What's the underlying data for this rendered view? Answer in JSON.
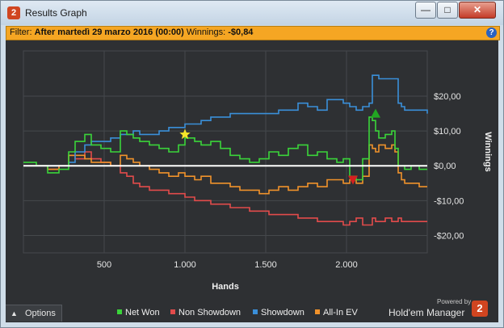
{
  "window": {
    "title": "Results Graph",
    "app_icon": "2"
  },
  "title_buttons": {
    "minimize": "—",
    "maximize": "□",
    "close": "✕"
  },
  "filter": {
    "prefix": "Filter:",
    "value": "After martedì 29 marzo 2016 (00:00)",
    "winnings_label": "Winnings:",
    "winnings_value": "-$0,84"
  },
  "footer": {
    "options_label": "Options",
    "powered_by": "Powered by",
    "brand": "Hold'em Manager",
    "brand_logo": "2"
  },
  "colors": {
    "net_won": "#3ad43a",
    "non_showdown": "#e24b4b",
    "showdown": "#3a8fd9",
    "all_in_ev": "#f0922b",
    "background": "#2e3033",
    "grid": "#45484c",
    "zero_line": "#ffffff",
    "accent": "#f5a623"
  },
  "chart_data": {
    "type": "line",
    "xlabel": "Hands",
    "ylabel": "Winnings",
    "xlim": [
      0,
      2500
    ],
    "ylim": [
      -25,
      33
    ],
    "x_ticks": [
      500,
      1000,
      1500,
      2000
    ],
    "x_tick_labels": [
      "500",
      "1.000",
      "1.500",
      "2.000"
    ],
    "y_ticks": [
      20,
      10,
      0,
      -10,
      -20
    ],
    "y_tick_labels": [
      "$20,00",
      "$10,00",
      "$0,00",
      "-$10,00",
      "-$20,00"
    ],
    "grid": true,
    "legend": "bottom",
    "x": [
      0,
      80,
      150,
      220,
      280,
      320,
      380,
      420,
      480,
      540,
      600,
      640,
      680,
      720,
      780,
      840,
      900,
      960,
      1000,
      1060,
      1100,
      1160,
      1220,
      1280,
      1340,
      1400,
      1460,
      1520,
      1580,
      1640,
      1700,
      1760,
      1820,
      1880,
      1940,
      1980,
      2020,
      2060,
      2100,
      2140,
      2160,
      2180,
      2200,
      2240,
      2280,
      2300,
      2320,
      2340,
      2360,
      2400,
      2450,
      2500
    ],
    "series": [
      {
        "name": "Net Won",
        "values": [
          1,
          0,
          -2,
          -1,
          4,
          7,
          9,
          6,
          5,
          4,
          10,
          9,
          8,
          7,
          6,
          5,
          4,
          6,
          8,
          7,
          6,
          7,
          5,
          3,
          2,
          1,
          2,
          4,
          3,
          5,
          6,
          3,
          4,
          2,
          1,
          2,
          -3,
          -4,
          2,
          14,
          13,
          10,
          8,
          9,
          10,
          5,
          0,
          0,
          -1,
          0,
          -1,
          -1
        ]
      },
      {
        "name": "Non Showdown",
        "values": [
          0,
          0,
          -1,
          0,
          3,
          2,
          4,
          2,
          1,
          0,
          -2,
          -3,
          -5,
          -6,
          -7,
          -7,
          -8,
          -8,
          -9,
          -10,
          -10,
          -11,
          -11,
          -12,
          -12,
          -13,
          -13,
          -14,
          -14,
          -14,
          -15,
          -15,
          -16,
          -16,
          -16,
          -17,
          -16,
          -15,
          -17,
          -17,
          -15,
          -16,
          -16,
          -15,
          -16,
          -16,
          -15,
          -16,
          -16,
          -16,
          -16,
          -16
        ]
      },
      {
        "name": "Showdown",
        "values": [
          0,
          0,
          0,
          0,
          1,
          4,
          6,
          7,
          7,
          8,
          9,
          9,
          10,
          9,
          9,
          10,
          11,
          11,
          12,
          12,
          13,
          14,
          14,
          15,
          15,
          15,
          15,
          15,
          16,
          16,
          18,
          17,
          16,
          19,
          19,
          18,
          17,
          16,
          17,
          18,
          26,
          26,
          25,
          25,
          25,
          25,
          18,
          17,
          16,
          16,
          16,
          15
        ]
      },
      {
        "name": "All-In EV",
        "values": [
          0,
          0,
          -1,
          0,
          3,
          3,
          2,
          1,
          1,
          0,
          3,
          2,
          1,
          0,
          -1,
          -2,
          -3,
          -2,
          -3,
          -4,
          -3,
          -5,
          -5,
          -6,
          -7,
          -7,
          -8,
          -7,
          -6,
          -7,
          -6,
          -5,
          -6,
          -4,
          -4,
          -5,
          -4,
          -5,
          -3,
          6,
          5,
          4,
          6,
          5,
          6,
          4,
          -2,
          -4,
          -5,
          -5,
          -6,
          -6
        ]
      }
    ],
    "markers": [
      {
        "type": "star",
        "series": "Net Won",
        "x": 1000,
        "y": 9,
        "color": "#f5e52a"
      },
      {
        "type": "triangle-up",
        "series": "Net Won",
        "x": 2180,
        "y": 15,
        "color": "#22a622"
      },
      {
        "type": "triangle-down",
        "series": "Net Won",
        "x": 2040,
        "y": -4,
        "color": "#d42020"
      }
    ]
  }
}
